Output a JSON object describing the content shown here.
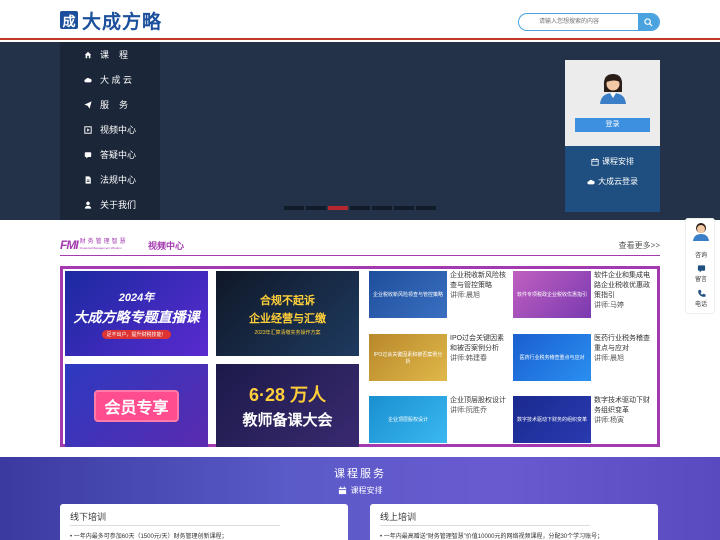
{
  "header": {
    "logo_mark": "成",
    "logo_text": "大成方略",
    "search_placeholder": "请输入您想搜索的内容"
  },
  "nav": {
    "items": [
      {
        "icon": "home-icon",
        "label": "课    程"
      },
      {
        "icon": "cloud-icon",
        "label": "大 成 云"
      },
      {
        "icon": "send-icon",
        "label": "服    务"
      },
      {
        "icon": "video-icon",
        "label": "视频中心"
      },
      {
        "icon": "qa-icon",
        "label": "答疑中心"
      },
      {
        "icon": "document-icon",
        "label": "法规中心"
      },
      {
        "icon": "user-icon",
        "label": "关于我们"
      }
    ]
  },
  "login_card": {
    "login_label": "登录",
    "schedule_label": "课程安排",
    "cloud_login_label": "大成云登录"
  },
  "video_center": {
    "brand_big": "FMI",
    "brand_small": "财务管理智慧",
    "brand_en": "Financial Management Wisdom",
    "title": "视频中心",
    "more": "查看更多>>",
    "big_tiles": [
      {
        "h": "2024年",
        "m": "大成方略专题直播课",
        "s": "足不出户，提升财税技能！"
      },
      {
        "h": "合规不起诉",
        "m": "企业经营与汇缴",
        "s": "2023年汇算清缴实务操作方案"
      },
      {
        "h": "会员专享"
      },
      {
        "h": "6·28 万人",
        "m": "教师备课大会"
      }
    ],
    "courses": [
      {
        "thumb": "企业税收新风险领查与管控策略",
        "title": "企业税收新风险核查与管控策略",
        "teacher": "讲师:晨旭"
      },
      {
        "thumb": "软件专项税政企业税收优惠指引",
        "title": "软件企业和集成电路企业税收优惠政策指引",
        "teacher": "讲师:马婷"
      },
      {
        "thumb": "IPO过会关键因素和被否案例分析",
        "title": "IPO过会关键因素和被否案例分析",
        "teacher": "讲师:韩建春"
      },
      {
        "thumb": "医药行业税务稽查重点与应对",
        "title": "医药行业税务稽查重点与应对",
        "teacher": "讲师:晨旭"
      },
      {
        "thumb": "企业顶层股权设计",
        "title": "企业顶层股权设计",
        "teacher": "讲师:阮胜乔"
      },
      {
        "thumb": "数字技术驱动下财务的组织变革",
        "title": "数字技术驱动下财务组织变革",
        "teacher": "讲师:杨寅"
      }
    ]
  },
  "services": {
    "title": "课程服务",
    "schedule": "课程安排",
    "cards": [
      {
        "title": "线下培训",
        "body": "• 一年内最多可参加60天（1500元/天）财务管理创新课程；"
      },
      {
        "title": "线上培训",
        "body": "• 一年内最高赠送“财务管理智慧”价值10000元的网络视频课程，分配30个学习账号；"
      }
    ]
  },
  "side": {
    "consult": "咨询",
    "message": "留言",
    "phone": "电话"
  }
}
